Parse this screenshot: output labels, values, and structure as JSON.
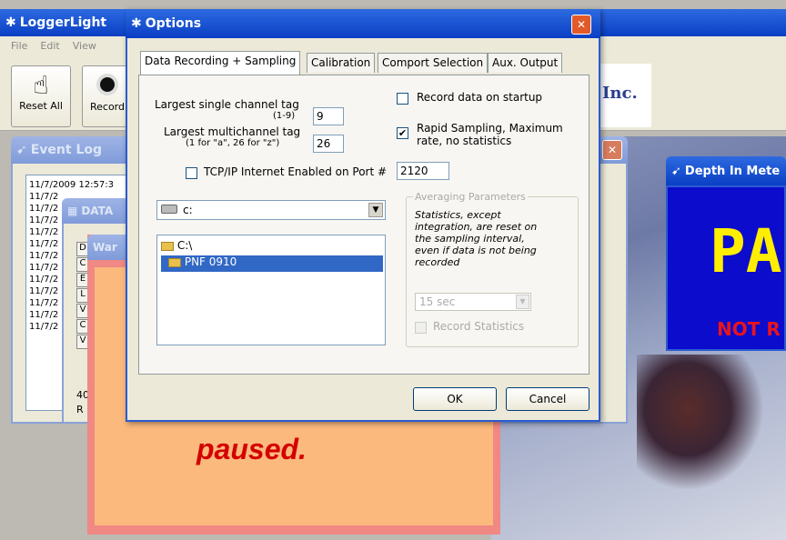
{
  "main_window": {
    "title": "LoggerLight",
    "menu": [
      "File",
      "Edit",
      "View"
    ],
    "toolbar": {
      "reset_label": "Reset All",
      "record_label": "Record"
    },
    "company_text": "Inc."
  },
  "event_log": {
    "title": "Event Log",
    "rows": [
      "11/7/2009 12:57:3",
      "11/7/2",
      "11/7/2",
      "11/7/2",
      "11/7/2",
      "11/7/2",
      "11/7/2",
      "11/7/2",
      "11/7/2",
      "11/7/2",
      "11/7/2",
      "11/7/2",
      "11/7/2"
    ]
  },
  "data_window": {
    "title": "DATA",
    "items": [
      "D",
      "C",
      "E",
      "L",
      "V",
      "C",
      "V"
    ],
    "bottom_values": [
      "40",
      "R"
    ]
  },
  "warning_window": {
    "title": "War",
    "message": "paused."
  },
  "depth_window": {
    "title": "Depth In Mete",
    "big_text": "PA",
    "status_text": "NOT R"
  },
  "options": {
    "title": "Options",
    "tabs": [
      "Data Recording + Sampling",
      "Calibration",
      "Comport Selection",
      "Aux. Output"
    ],
    "single_tag_label_1": "Largest single channel tag",
    "single_tag_label_2": "(1-9)",
    "single_tag_value": "9",
    "multi_tag_label_1": "Largest multichannel tag",
    "multi_tag_label_2": "(1 for \"a\", 26 for \"z\")",
    "multi_tag_value": "26",
    "tcp_label": "TCP/IP Internet Enabled on Port #",
    "tcp_port": "2120",
    "tcp_checked": false,
    "record_on_startup_label": "Record data on startup",
    "record_on_startup_checked": false,
    "rapid_label_1": "Rapid Sampling, Maximum",
    "rapid_label_2": "rate, no statistics",
    "rapid_checked": true,
    "drive_value": "c:",
    "folders": [
      "C:\\",
      "PNF 0910"
    ],
    "averaging": {
      "legend": "Averaging Parameters",
      "desc_lines": [
        "Statistics, except",
        "integration, are reset on",
        "the sampling interval,",
        "even if data is not being",
        "recorded"
      ],
      "interval_value": "15 sec",
      "record_stats_label": "Record Statistics"
    },
    "ok_label": "OK",
    "cancel_label": "Cancel"
  }
}
